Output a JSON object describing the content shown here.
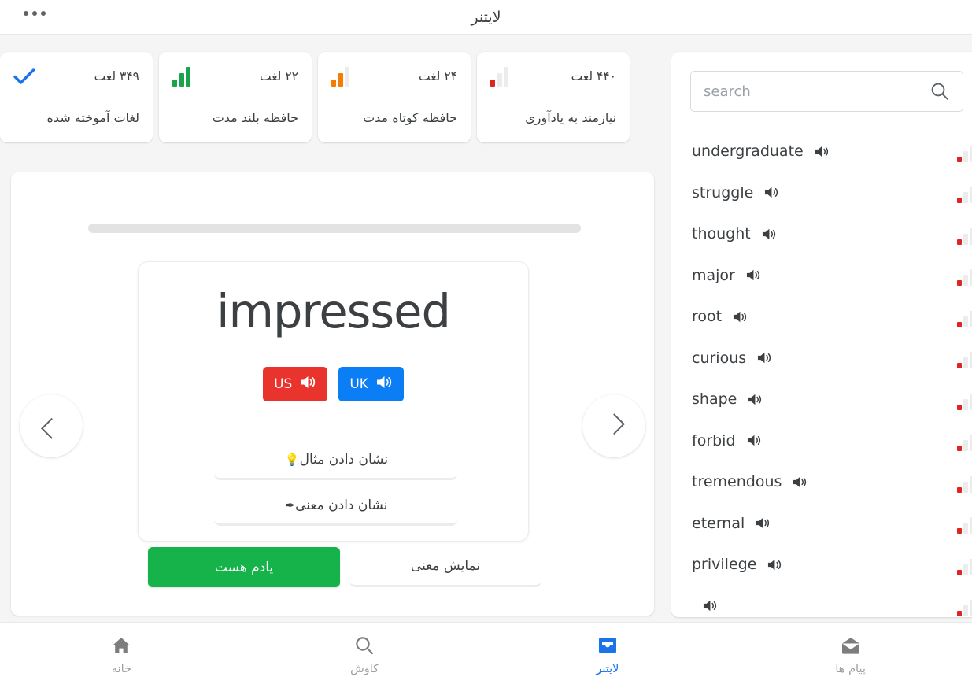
{
  "header": {
    "title": "لایتنر",
    "menu_icon": "more-horizontal-icon"
  },
  "stats": [
    {
      "count": "۳۴۹ لغت",
      "label": "لغات آموخته شده",
      "icon": "check-icon",
      "icon_color": "#1a73e8",
      "bars": []
    },
    {
      "count": "۲۲ لغت",
      "label": "حافظه بلند مدت",
      "icon": "bar-chart-icon",
      "icon_color": "#1aa34a",
      "bars": [
        "#1aa34a",
        "#1aa34a",
        "#1aa34a"
      ]
    },
    {
      "count": "۲۴ لغت",
      "label": "حافظه کوتاه مدت",
      "icon": "bar-chart-icon",
      "icon_color": "#f57c00",
      "bars": [
        "#f57c00",
        "#f57c00",
        "#ececec"
      ]
    },
    {
      "count": "۴۴۰ لغت",
      "label": "نیازمند به یادآوری",
      "icon": "bar-chart-icon",
      "icon_color": "#e02424",
      "bars": [
        "#e02424",
        "#ececec",
        "#ececec"
      ]
    }
  ],
  "flashcard": {
    "progress_percent": 0,
    "word": "impressed",
    "accents": [
      {
        "label": "US",
        "color": "#e8342c",
        "icon": "speaker-icon"
      },
      {
        "label": "UK",
        "color": "#0b7ef5",
        "icon": "speaker-icon"
      }
    ],
    "reveal_buttons": [
      {
        "label": "نشان دادن مثال",
        "icon": "lightbulb-icon",
        "glyph": "💡"
      },
      {
        "label": "نشان دادن معنی",
        "icon": "pen-icon",
        "glyph": "✒"
      }
    ],
    "prev_icon": "chevron-left-icon",
    "next_icon": "chevron-right-icon"
  },
  "actions": {
    "remember_label": "یادم هست",
    "remember_color": "#16b34a",
    "show_meaning_label": "نمایش معنی"
  },
  "sidebar": {
    "search": {
      "placeholder": "search",
      "value": "",
      "icon": "search-icon"
    },
    "words": [
      {
        "word": "undergraduate",
        "speaker_icon": "speaker-icon",
        "level_color": "#e02424"
      },
      {
        "word": "struggle",
        "speaker_icon": "speaker-icon",
        "level_color": "#e02424"
      },
      {
        "word": "thought",
        "speaker_icon": "speaker-icon",
        "level_color": "#e02424"
      },
      {
        "word": "major",
        "speaker_icon": "speaker-icon",
        "level_color": "#e02424"
      },
      {
        "word": "root",
        "speaker_icon": "speaker-icon",
        "level_color": "#e02424"
      },
      {
        "word": "curious",
        "speaker_icon": "speaker-icon",
        "level_color": "#e02424"
      },
      {
        "word": "shape",
        "speaker_icon": "speaker-icon",
        "level_color": "#e02424"
      },
      {
        "word": "forbid",
        "speaker_icon": "speaker-icon",
        "level_color": "#e02424"
      },
      {
        "word": "tremendous",
        "speaker_icon": "speaker-icon",
        "level_color": "#e02424"
      },
      {
        "word": "eternal",
        "speaker_icon": "speaker-icon",
        "level_color": "#e02424"
      },
      {
        "word": "privilege",
        "speaker_icon": "speaker-icon",
        "level_color": "#e02424"
      },
      {
        "word": "",
        "speaker_icon": "speaker-icon",
        "level_color": "#e02424"
      }
    ]
  },
  "bottom_nav": {
    "active_color": "#1a73e8",
    "items": [
      {
        "label": "خانه",
        "icon": "home-icon",
        "active": false
      },
      {
        "label": "کاوش",
        "icon": "search-icon",
        "active": false
      },
      {
        "label": "لایتنر",
        "icon": "inbox-icon",
        "active": true
      },
      {
        "label": "پیام ها",
        "icon": "envelope-icon",
        "active": false
      }
    ]
  }
}
